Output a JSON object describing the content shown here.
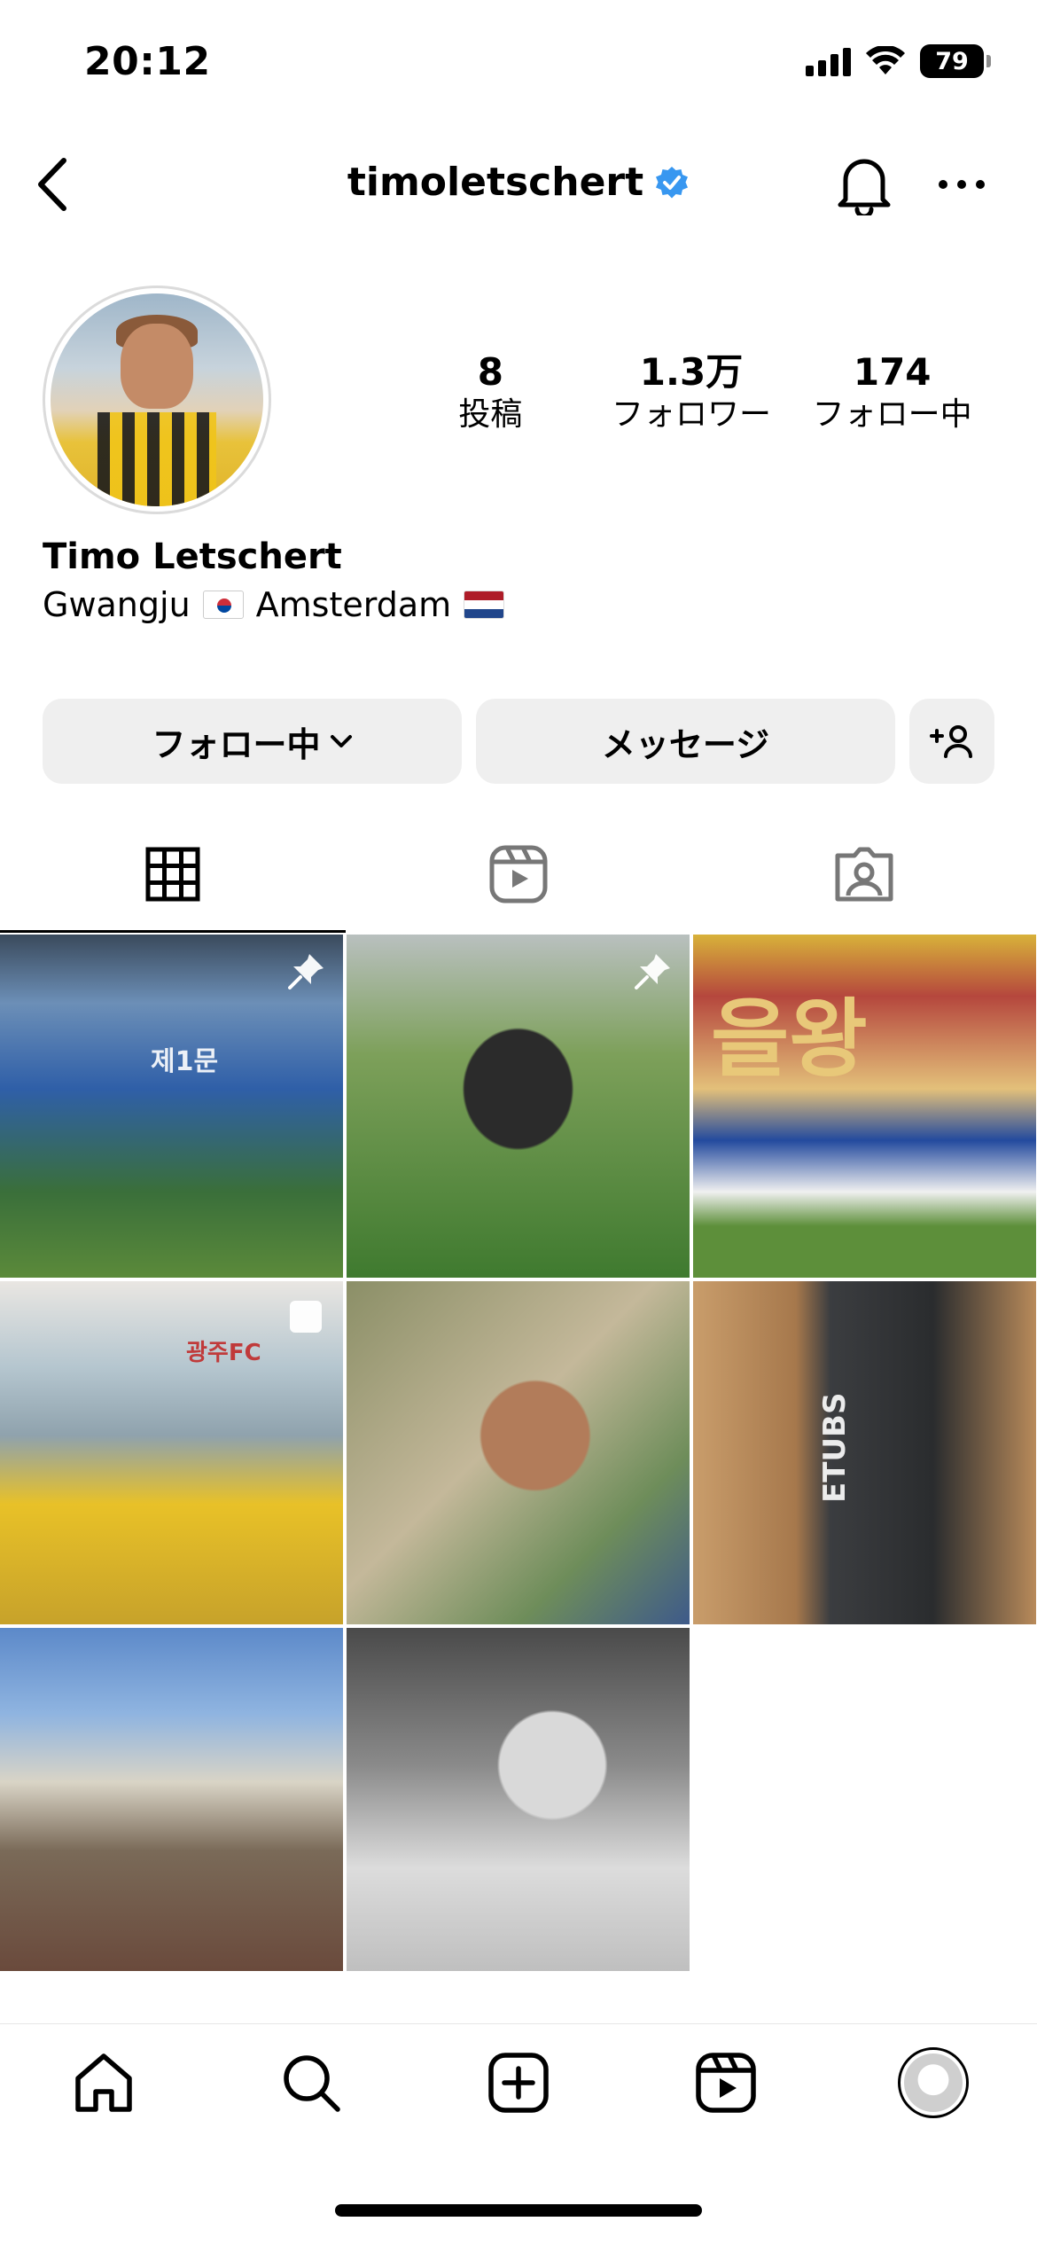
{
  "status_bar": {
    "time": "20:12",
    "battery": "79"
  },
  "header": {
    "username": "timoletschert"
  },
  "profile": {
    "stats": [
      {
        "value": "8",
        "label": "投稿"
      },
      {
        "value": "1.3万",
        "label": "フォロワー"
      },
      {
        "value": "174",
        "label": "フォロー中"
      }
    ],
    "full_name": "Timo Letschert",
    "bio": {
      "city1": "Gwangju",
      "city2": "Amsterdam"
    }
  },
  "actions": {
    "following_label": "フォロー中",
    "message_label": "メッセージ"
  },
  "grid_cells": [
    {
      "text": "제1문"
    },
    {
      "text": ""
    },
    {
      "text": "을왕"
    },
    {
      "text": "광주FC"
    },
    {
      "text": ""
    },
    {
      "text": "ETUBS"
    },
    {
      "text": ""
    },
    {
      "text": ""
    }
  ],
  "icons": {
    "back": "chevron-left-icon",
    "verified": "verified-badge-icon",
    "bell": "bell-icon",
    "more": "more-icon",
    "pin": "pin-icon",
    "grid": "grid-icon",
    "reels": "reels-icon",
    "tagged": "tagged-icon",
    "home": "home-icon",
    "search": "search-icon",
    "create": "plus-square-icon"
  },
  "colors": {
    "verified": "#3897f0",
    "button_bg": "#efefef"
  }
}
